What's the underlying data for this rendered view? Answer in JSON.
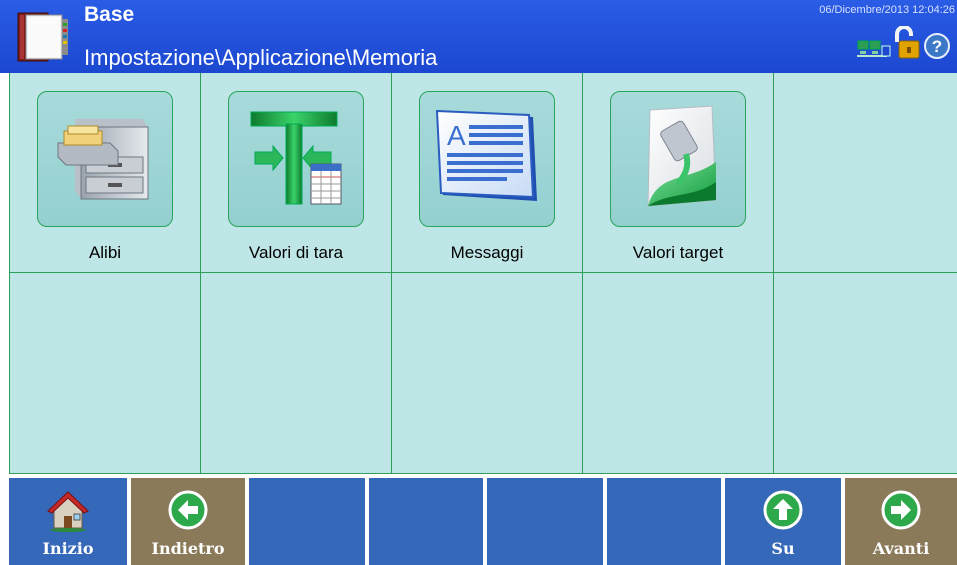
{
  "header": {
    "title": "Base",
    "path": "Impostazione\\Applicazione\\Memoria",
    "datetime": "06/Dicembre/2013 12:04:26",
    "logo_icon": "book-icon",
    "status_icons": [
      "network-icon",
      "unlocked-padlock-icon",
      "help-icon"
    ]
  },
  "tiles": [
    {
      "label": "Alibi",
      "icon": "file-cabinet-icon"
    },
    {
      "label": "Valori di tara",
      "icon": "tare-table-icon"
    },
    {
      "label": "Messaggi",
      "icon": "message-document-icon"
    },
    {
      "label": "Valori target",
      "icon": "target-paint-icon"
    }
  ],
  "footer": {
    "home_label": "Inizio",
    "back_label": "Indietro",
    "up_label": "Su",
    "next_label": "Avanti"
  },
  "colors": {
    "header_bg": "#1f4fd8",
    "grid_bg": "#bfe6e6",
    "grid_line": "#2e9f57",
    "footer_blue": "#3568b8",
    "footer_olive": "#8b7a5a"
  }
}
